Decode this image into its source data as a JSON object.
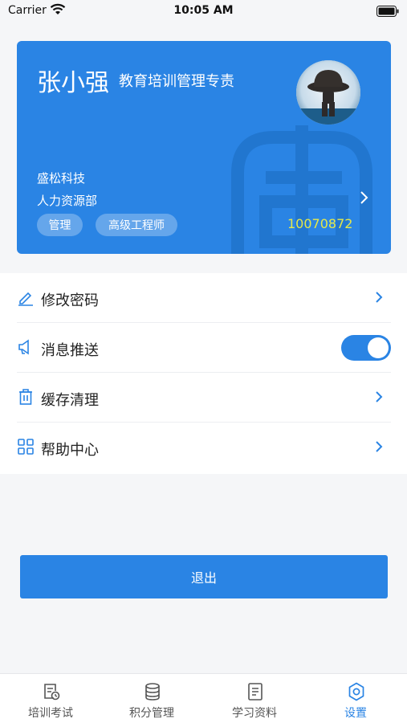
{
  "status_bar": {
    "carrier": "Carrier",
    "time": "10:05 AM"
  },
  "profile": {
    "name": "张小强",
    "title": "教育培训管理专责",
    "company": "盛松科技",
    "department": "人力资源部",
    "tags": [
      "管理",
      "高级工程师"
    ],
    "employee_id": "10070872"
  },
  "settings": {
    "items": [
      {
        "label": "修改密码",
        "icon": "edit-pencil-icon",
        "control": "arrow"
      },
      {
        "label": "消息推送",
        "icon": "megaphone-icon",
        "control": "toggle",
        "enabled": true
      },
      {
        "label": "缓存清理",
        "icon": "trash-icon",
        "control": "arrow"
      },
      {
        "label": "帮助中心",
        "icon": "grid-icon",
        "control": "arrow"
      }
    ]
  },
  "logout_label": "退出",
  "tab_bar": {
    "tabs": [
      {
        "label": "培训考试",
        "icon": "exam-document-icon",
        "active": false
      },
      {
        "label": "积分管理",
        "icon": "coins-stack-icon",
        "active": false
      },
      {
        "label": "学习资料",
        "icon": "document-icon",
        "active": false
      },
      {
        "label": "设置",
        "icon": "gear-icon",
        "active": true
      }
    ]
  },
  "colors": {
    "accent": "#2a84e4",
    "id_text": "#e5e84a",
    "background": "#f5f6f8"
  }
}
